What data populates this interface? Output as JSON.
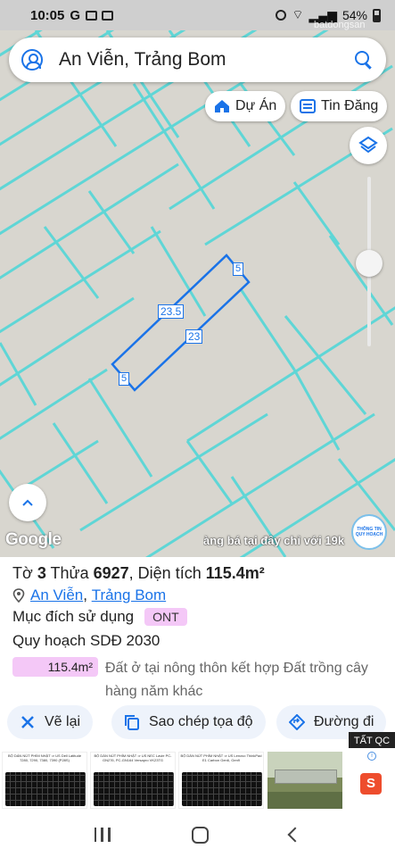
{
  "status_bar": {
    "time": "10:05",
    "g_label": "G",
    "battery": "54%"
  },
  "watermark": "batdongsan",
  "search": {
    "text": "An Viễn, Trảng Bom"
  },
  "chips": {
    "du_an": "Dự Án",
    "tin_dang": "Tin Đăng"
  },
  "map": {
    "google_label": "Google",
    "marquee_text": "àng bá tại đây chỉ với 19k",
    "planning_badge": "THÔNG TIN QUY HOẠCH",
    "parcel_dimensions": {
      "top_side": "5",
      "long_side_left": "23.5",
      "long_side_right": "23",
      "bottom_side": "5"
    }
  },
  "parcel": {
    "to_label": "Tờ",
    "to_value": "3",
    "thua_label": "Thửa",
    "thua_value": "6927",
    "dien_tich_label": ", Diện tích",
    "dien_tich_value": "115.4m²",
    "location_ward": "An Viễn",
    "location_district": "Trảng Bom",
    "muc_dich_label": "Mục đích sử dụng",
    "muc_dich_value": "ONT",
    "quy_hoach": "Quy hoạch SDĐ 2030",
    "area_value": "115.4m²",
    "area_description": "Đất ở tại nông thôn kết hợp Đất trồng cây hàng năm khác"
  },
  "actions": {
    "draw": "Vẽ lại",
    "copy_coords": "Sao chép tọa độ",
    "directions": "Đường đi"
  },
  "ads": {
    "tag": "TẤT QC",
    "items": [
      {
        "caption": "BỘ DÁN NÚT PHÍM NHẬT ⇒ US Dell Latitude 7280, 7290, 7380, 7390 (P28S)"
      },
      {
        "caption": "BỘ DÁN NÚT PHÍM NHẬT ⇒ US NEC Lavie PC-GN276, PC-GN164 Versapro VK23TG"
      },
      {
        "caption": "BỘ DÁN NÚT PHÍM NHẬT ⇒ US Lenovo ThinkPad E1 Carbon Gen6, Gen9"
      }
    ]
  },
  "colors": {
    "accent": "#1a73e8",
    "parcel_line": "#5fd6d6",
    "badge_pink": "#f4c8f7"
  }
}
